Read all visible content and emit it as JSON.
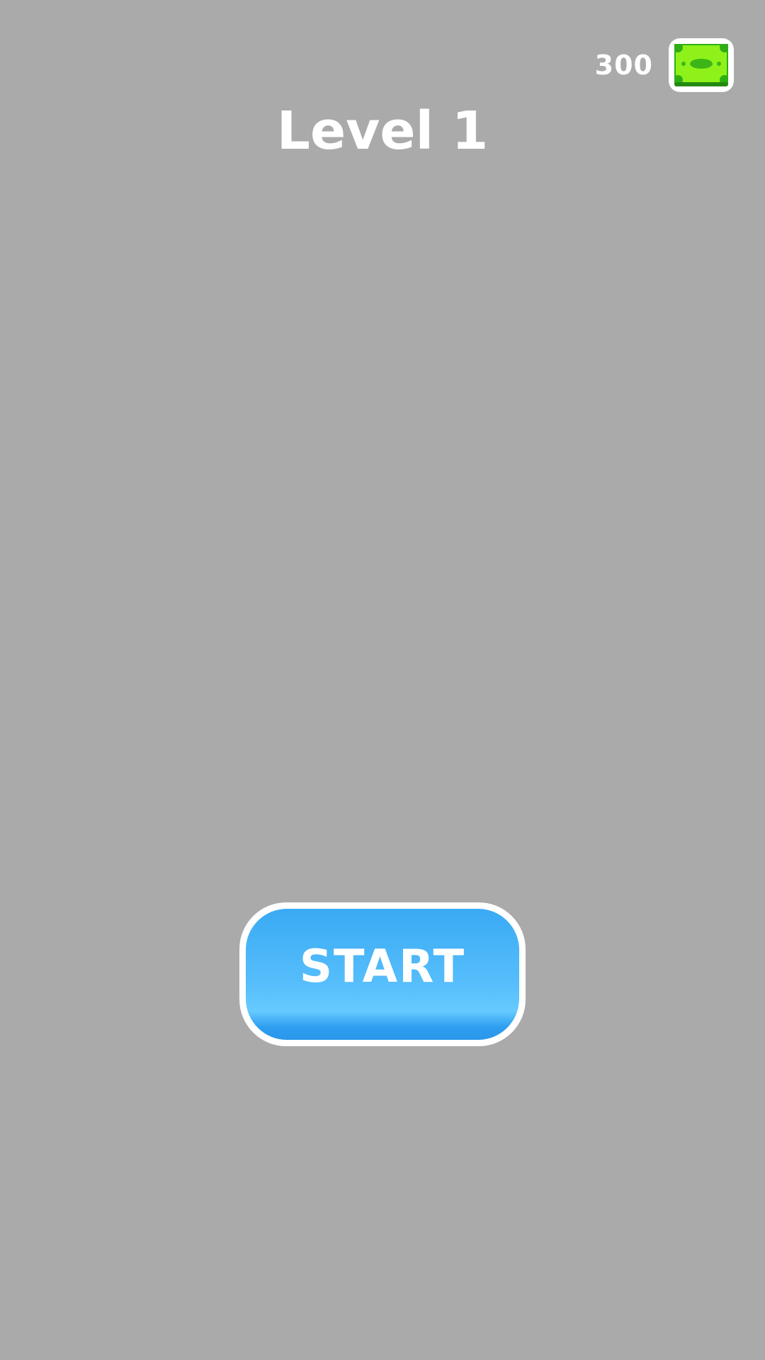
{
  "hud": {
    "currency_count": "300",
    "currency_icon": "cash-icon"
  },
  "level": {
    "title": "Level 1"
  },
  "start_button": {
    "label": "START"
  },
  "colors": {
    "background": "#aaaaaa",
    "button_blue": "#3aaaf4",
    "cash_green": "#8ef21a"
  }
}
